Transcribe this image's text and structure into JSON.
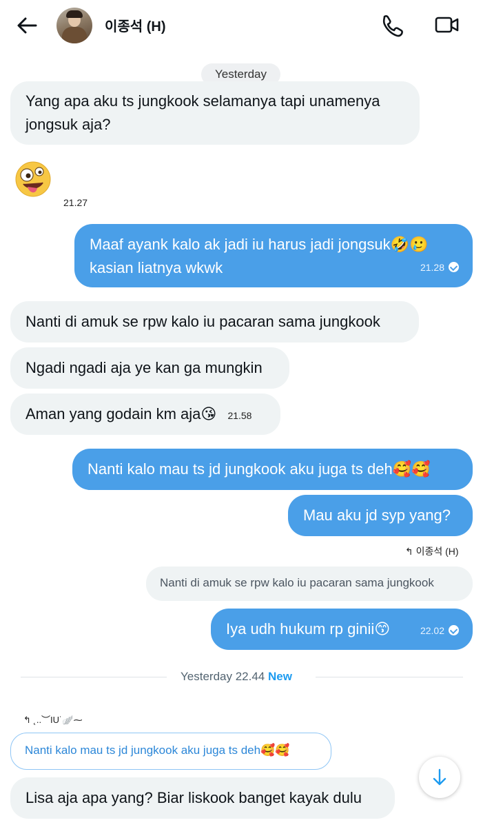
{
  "header": {
    "contact_name": "이종석 (H)",
    "back_icon": "arrow-left-icon",
    "call_icon": "phone-icon",
    "video_icon": "video-camera-icon"
  },
  "day_separator": "Yesterday",
  "messages": [
    {
      "id": "m1",
      "direction": "in",
      "text": "Yang apa aku ts jungkook selamanya tapi unamenya",
      "text2": "jongsuk aja?"
    },
    {
      "id": "m2",
      "direction": "in",
      "emoji": "🤪",
      "time": "21.27"
    },
    {
      "id": "m3",
      "direction": "out",
      "text": "Maaf ayank kalo ak jadi iu harus jadi jongsuk🤣🥲",
      "text2": "kasian liatnya wkwk",
      "time": "21.28",
      "status": "read"
    },
    {
      "id": "m4",
      "direction": "in",
      "text": "Nanti di amuk se rpw kalo iu pacaran sama jungkook"
    },
    {
      "id": "m5",
      "direction": "in",
      "text": "Ngadi ngadi aja ye kan ga mungkin"
    },
    {
      "id": "m6",
      "direction": "in",
      "text": "Aman yang godain km aja😘",
      "time": "21.58"
    },
    {
      "id": "m7",
      "direction": "out",
      "text": "Nanti kalo mau ts jd jungkook aku juga ts deh🥰🥰"
    },
    {
      "id": "m8",
      "direction": "out",
      "text": "Mau aku jd syp yang?"
    },
    {
      "id": "m9",
      "direction": "out",
      "reply_to_label": "↰ 이종석 (H)",
      "quoted": "Nanti di amuk se rpw kalo iu pacaran sama jungkook",
      "text": "Iya udh hukum rp ginii😙",
      "time": "22.02",
      "status": "read"
    },
    {
      "id": "m10",
      "direction": "in",
      "reply_to_label": "↰ ˛..︶IU˙🪽⁓",
      "quoted": "Nanti kalo mau ts jd jungkook aku juga ts deh🥰🥰",
      "text": "Lisa aja apa yang? Biar liskook banget kayak dulu"
    }
  ],
  "new_divider": {
    "text": "Yesterday 22.44",
    "badge": "New"
  },
  "scroll_button": {
    "icon": "arrow-down-icon"
  },
  "colors": {
    "outgoing": "#4a9fe8",
    "incoming": "#eff3f4",
    "accent": "#1d9bf0"
  }
}
